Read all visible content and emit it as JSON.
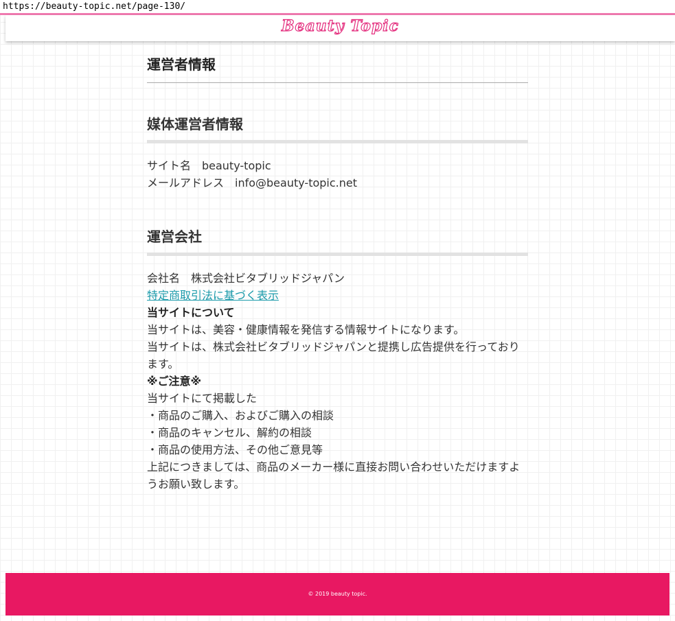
{
  "browser": {
    "url": "https://beauty-topic.net/page-130/"
  },
  "header": {
    "logo_text": "Beauty Topic"
  },
  "page": {
    "title": "運営者情報"
  },
  "media_section": {
    "heading": "媒体運営者情報",
    "site_name_line": "サイト名　beauty-topic",
    "email_line": "メールアドレス　info@beauty-topic.net"
  },
  "company_section": {
    "heading": "運営会社",
    "company_name_line": "会社名　株式会社ビタブリッドジャパン",
    "tokusho_link": "特定商取引法に基づく表示",
    "about_heading": "当サイトについて",
    "about_line1": "当サイトは、美容・健康情報を発信する情報サイトになります。",
    "about_line2": "当サイトは、株式会社ビタブリッドジャパンと提携し広告提供を行っております。",
    "notice_heading": "※ご注意※",
    "notice_intro": "当サイトにて掲載した",
    "notice_items": [
      "・商品のご購入、およびご購入の相談",
      "・商品のキャンセル、解約の相談",
      "・商品の使用方法、その他ご意見等"
    ],
    "notice_footer": "上記につきましては、商品のメーカー様に直接お問い合わせいただけますようお願い致します。"
  },
  "footer": {
    "copyright": "© 2019 beauty topic."
  },
  "colors": {
    "accent_pink": "#e81862",
    "header_line": "#f07ab0",
    "link": "#1a9aaa"
  }
}
